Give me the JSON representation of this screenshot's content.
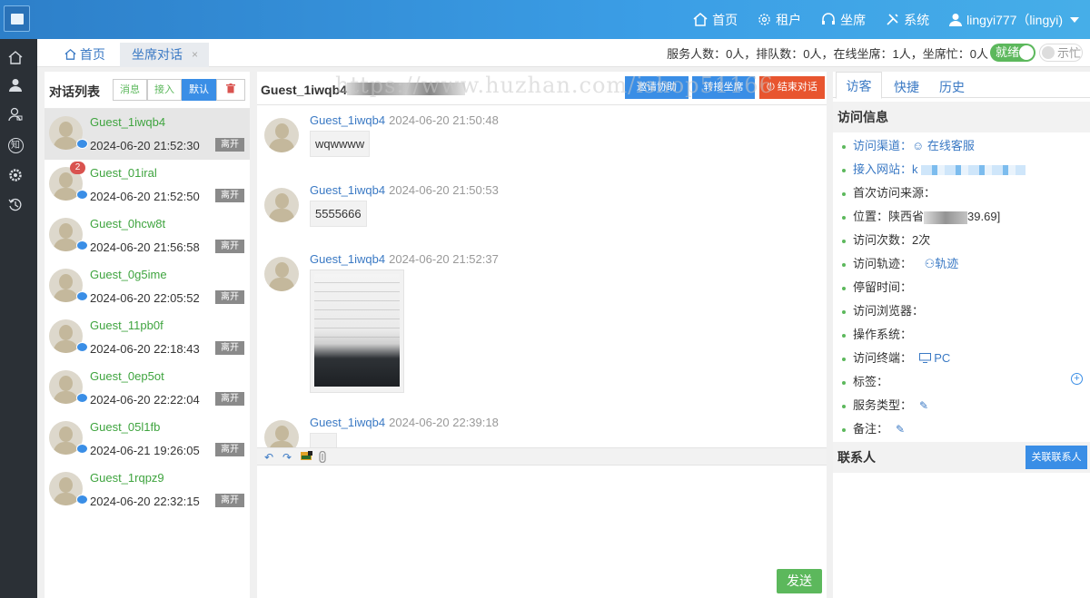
{
  "topnav": {
    "items": [
      {
        "label": "首页",
        "icon": "home-icon"
      },
      {
        "label": "租户",
        "icon": "gear-icon"
      },
      {
        "label": "坐席",
        "icon": "headset-icon"
      },
      {
        "label": "系统",
        "icon": "tools-icon"
      }
    ],
    "user": "lingyi777（lingyi)"
  },
  "sidebar": {
    "icons": [
      "home-icon",
      "user-icon",
      "contacts-icon",
      "knowledge-icon",
      "settings-icon",
      "history-icon"
    ],
    "knowledge_glyph": "知"
  },
  "tabs": {
    "home": "首页",
    "active": "坐席对话",
    "close": "×"
  },
  "stats": {
    "text": "服务人数：0人，排队数：0人，在线坐席：1人，坐席忙：0人",
    "ready": "就绪",
    "busy": "示忙"
  },
  "conversation_list": {
    "title": "对话列表",
    "filters": {
      "messages": "消息",
      "accept": "接入",
      "default": "默认"
    },
    "guests": [
      {
        "name": "Guest_1iwqb4",
        "time": "2024-06-20 21:52:30",
        "status": "离开",
        "unread": ""
      },
      {
        "name": "Guest_01iral",
        "time": "2024-06-20 21:52:50",
        "status": "离开",
        "unread": "2"
      },
      {
        "name": "Guest_0hcw8t",
        "time": "2024-06-20 21:56:58",
        "status": "离开",
        "unread": ""
      },
      {
        "name": "Guest_0g5ime",
        "time": "2024-06-20 22:05:52",
        "status": "离开",
        "unread": ""
      },
      {
        "name": "Guest_11pb0f",
        "time": "2024-06-20 22:18:43",
        "status": "离开",
        "unread": ""
      },
      {
        "name": "Guest_0ep5ot",
        "time": "2024-06-20 22:22:04",
        "status": "离开",
        "unread": ""
      },
      {
        "name": "Guest_05l1fb",
        "time": "2024-06-21 19:26:05",
        "status": "离开",
        "unread": ""
      },
      {
        "name": "Guest_1rqpz9",
        "time": "2024-06-20 22:32:15",
        "status": "离开",
        "unread": ""
      }
    ]
  },
  "chat": {
    "title": "Guest_1iwqb4",
    "buttons": {
      "invite": "邀请协助",
      "transfer": "转接坐席",
      "end": "结束对话"
    },
    "watermark": "https://www.huzhan.com/ishop51166",
    "messages": [
      {
        "sender": "Guest_1iwqb4",
        "time": "2024-06-20 21:50:48",
        "text": "wqwwww"
      },
      {
        "sender": "Guest_1iwqb4",
        "time": "2024-06-20 21:50:53",
        "text": "5555666"
      },
      {
        "sender": "Guest_1iwqb4",
        "time": "2024-06-20 21:52:37",
        "text": ""
      },
      {
        "sender": "Guest_1iwqb4",
        "time": "2024-06-20 22:39:18",
        "text": ""
      }
    ],
    "toolbar_icons": [
      "undo-icon",
      "redo-icon",
      "image-icon",
      "attachment-icon"
    ],
    "send": "发送"
  },
  "info_panel": {
    "tabs": [
      "访客",
      "快捷",
      "历史"
    ],
    "visit_title": "访问信息",
    "rows": {
      "channel_label": "访问渠道：",
      "channel_value": "在线客服",
      "site_label": "接入网站：",
      "site_value": "k",
      "first_source_label": "首次访问来源：",
      "location_label": "位置：",
      "location_value_a": "陕西省",
      "location_value_b": "39.69]",
      "visits_label": "访问次数：",
      "visits_value": "2次",
      "track_label": "访问轨迹：",
      "track_value": "轨迹",
      "stay_label": "停留时间：",
      "browser_label": "访问浏览器：",
      "os_label": "操作系统：",
      "device_label": "访问终端：",
      "device_value": "PC",
      "tags_label": "标签：",
      "service_type_label": "服务类型：",
      "remark_label": "备注："
    },
    "contact_title": "联系人",
    "link_contact": "关联联系人"
  }
}
